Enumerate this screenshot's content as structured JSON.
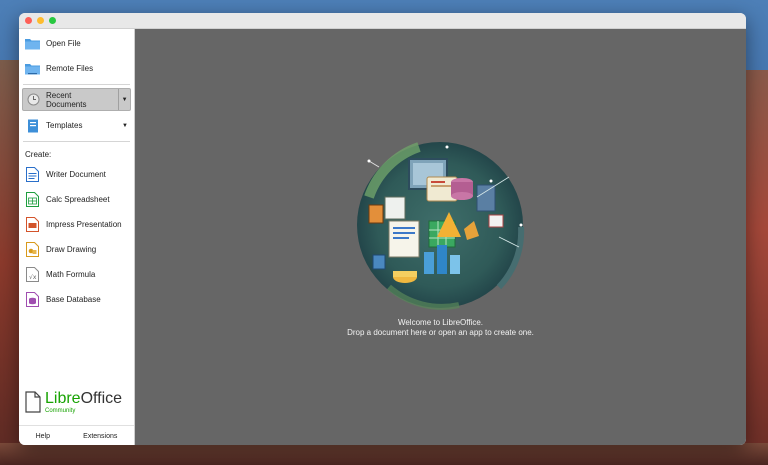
{
  "window": {
    "traffic_lights": [
      "close",
      "minimize",
      "maximize"
    ]
  },
  "sidebar": {
    "open_file": "Open File",
    "remote_files": "Remote Files",
    "recent_documents": "Recent Documents",
    "templates": "Templates",
    "create_label": "Create:",
    "create_items": {
      "writer": "Writer Document",
      "calc": "Calc Spreadsheet",
      "impress": "Impress Presentation",
      "draw": "Draw Drawing",
      "math": "Math Formula",
      "base": "Base Database"
    },
    "logo": {
      "libre": "Libre",
      "office": "Office",
      "sub": "Community"
    },
    "help": "Help",
    "extensions": "Extensions"
  },
  "main": {
    "welcome_line1": "Welcome to LibreOffice.",
    "welcome_line2": "Drop a document here or open an app to create one."
  },
  "colors": {
    "writer": "#2a6fc9",
    "calc": "#1f9e3f",
    "impress": "#d3542b",
    "draw": "#d89a1c",
    "math": "#8a8a8a",
    "base": "#a04eb0",
    "libre_green": "#18a303"
  },
  "icons": {
    "open_file": "folder-icon",
    "remote_files": "cloud-folder-icon",
    "recent": "clock-icon",
    "templates": "template-icon"
  }
}
